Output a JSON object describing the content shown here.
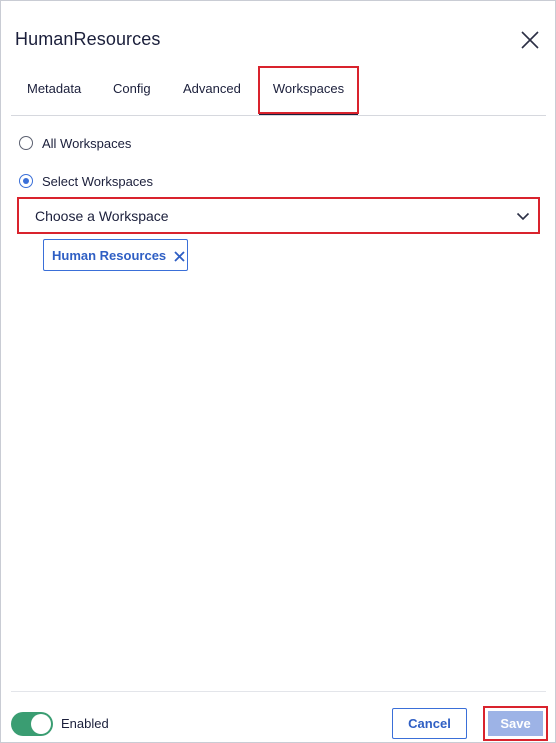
{
  "dialog": {
    "title": "HumanResources"
  },
  "tabs": [
    {
      "label": "Metadata"
    },
    {
      "label": "Config"
    },
    {
      "label": "Advanced"
    },
    {
      "label": "Workspaces",
      "active": true
    }
  ],
  "workspaces": {
    "options": [
      {
        "label": "All Workspaces",
        "checked": false
      },
      {
        "label": "Select Workspaces",
        "checked": true
      }
    ],
    "select": {
      "placeholder": "Choose a Workspace"
    },
    "selected_chips": [
      {
        "label": "Human Resources"
      }
    ]
  },
  "footer": {
    "toggle_label": "Enabled",
    "toggle_on": true,
    "cancel_label": "Cancel",
    "save_label": "Save"
  },
  "colors": {
    "accent": "#3a6fd8",
    "highlight": "#d9232d",
    "toggle_on": "#3a9d72",
    "save_disabled": "#9db3e6"
  }
}
